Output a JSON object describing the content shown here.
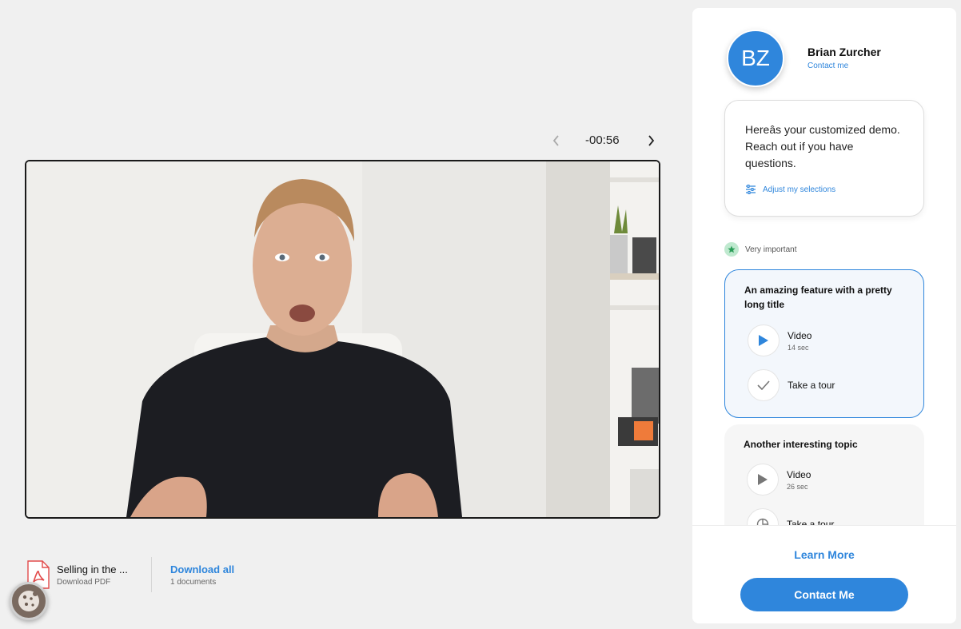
{
  "video_nav": {
    "time": "-00:56"
  },
  "documents": {
    "file_title": "Selling in the ...",
    "file_sub": "Download PDF",
    "download_all": "Download all",
    "download_count": "1 documents"
  },
  "rep": {
    "initials": "BZ",
    "name": "Brian Zurcher",
    "contact_link": "Contact me",
    "message": "Hereâs your customized demo. Reach out if you have questions.",
    "adjust_label": "Adjust my selections"
  },
  "importance_label": "Very important",
  "topics": [
    {
      "title": "An amazing feature with a pretty long title",
      "items": [
        {
          "label": "Video",
          "sub": "14 sec"
        },
        {
          "label": "Take a tour",
          "sub": ""
        }
      ]
    },
    {
      "title": "Another interesting topic",
      "items": [
        {
          "label": "Video",
          "sub": "26 sec"
        },
        {
          "label": "Take a tour",
          "sub": ""
        }
      ]
    }
  ],
  "footer": {
    "learn_more": "Learn More",
    "contact_button": "Contact Me"
  },
  "colors": {
    "accent": "#2f86dc",
    "important": "#3dbf6e"
  }
}
